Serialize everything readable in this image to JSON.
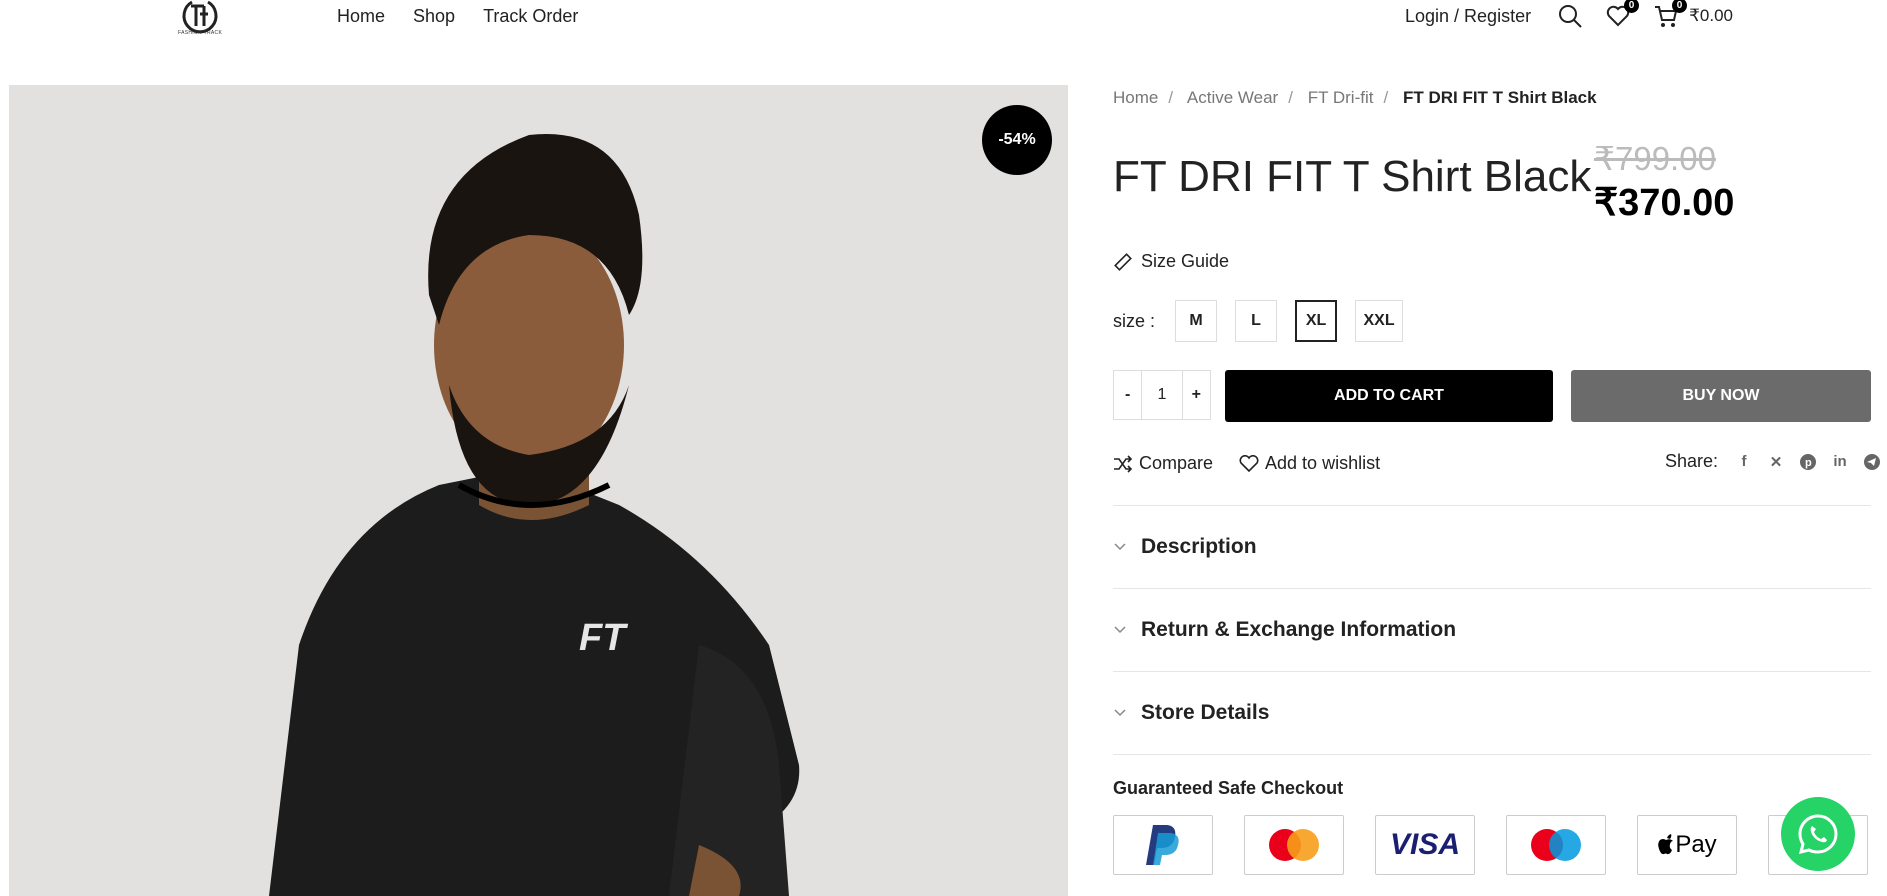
{
  "header": {
    "logo_text": "FASHION TRACK",
    "nav": [
      "Home",
      "Shop",
      "Track Order"
    ],
    "login_label": "Login / Register",
    "wishlist_count": "0",
    "cart_count": "0",
    "cart_total": "₹0.00"
  },
  "product": {
    "discount_badge": "-54%",
    "breadcrumb": [
      "Home",
      "Active Wear",
      "FT Dri-fit",
      "FT DRI FIT T Shirt Black"
    ],
    "title": "FT DRI FIT T Shirt Black",
    "old_price": "₹799.00",
    "new_price": "₹370.00",
    "size_guide_label": "Size Guide",
    "size_label": "size",
    "size_colon": ":",
    "sizes": [
      "M",
      "L",
      "XL",
      "XXL"
    ],
    "selected_size": "XL",
    "qty_minus": "-",
    "qty_value": "1",
    "qty_plus": "+",
    "add_to_cart_label": "ADD TO CART",
    "buy_now_label": "BUY NOW",
    "compare_label": "Compare",
    "wishlist_label": "Add to wishlist",
    "share_label": "Share:",
    "shirt_logo": "FT"
  },
  "accordion": [
    "Description",
    "Return & Exchange Information",
    "Store Details"
  ],
  "checkout": {
    "title": "Guaranteed Safe Checkout",
    "methods": [
      "PayPal",
      "Mastercard",
      "VISA",
      "Maestro",
      "Pay"
    ]
  },
  "colors": {
    "accent": "#000000",
    "buy_now": "#6b6b6b",
    "image_bg": "#e2e1df",
    "whatsapp": "#25d366"
  }
}
